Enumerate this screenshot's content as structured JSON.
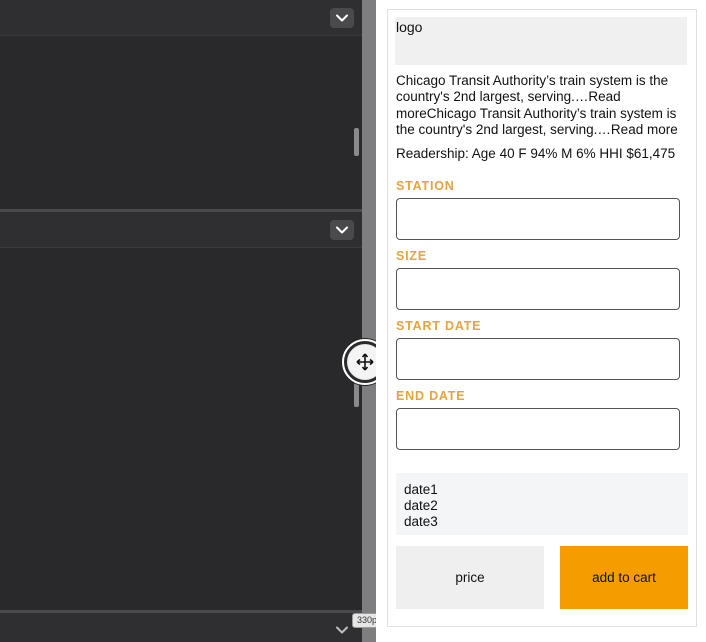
{
  "preview": {
    "logo_text": "logo",
    "description": "Chicago Transit Authority’s train system is the country's 2nd largest, serving.…Read moreChicago Transit Authority’s train system is the country's 2nd largest, serving.…Read more",
    "readership": "Readership: Age 40 F 94% M 6% HHI $61,475",
    "fields": {
      "station_label": "STATION",
      "size_label": "SIZE",
      "start_date_label": "START DATE",
      "end_date_label": "END DATE"
    },
    "dates": [
      "date1",
      "date2",
      "date3"
    ],
    "price_label": "price",
    "cart_label": "add to cart"
  },
  "editor": {
    "width_badge": "330px",
    "icons": {
      "panel_toggle": "chevron-down-icon",
      "resize": "move-arrows-icon"
    }
  },
  "colors": {
    "accent_label": "#e8a33d",
    "cart_button": "#f59c00",
    "editor_bg": "#2b2b2d"
  }
}
